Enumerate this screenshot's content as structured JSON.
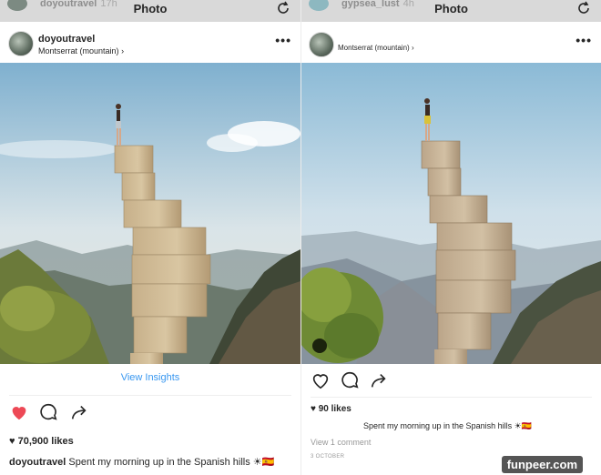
{
  "left_post": {
    "story_username": "doyoutravel",
    "story_time": "17h",
    "title": "Photo",
    "username": "doyoutravel",
    "location": "Montserrat (mountain)",
    "location_chevron": "›",
    "more": "•••",
    "view_insights": "View Insights",
    "likes": "70,900 likes",
    "caption_user": "doyoutravel",
    "caption_text": "Spent my morning up in the Spanish hills ☀🇪🇸"
  },
  "right_post": {
    "story_username": "gypsea_lust",
    "story_time": "4h",
    "title": "Photo",
    "location": "Montserrat (mountain)",
    "location_chevron": "›",
    "more": "•••",
    "likes": "90 likes",
    "caption_text": "Spent my morning up in the Spanish hills ☀🇪🇸",
    "view_comments": "View 1 comment",
    "date": "3 OCTOBER"
  },
  "icons": {
    "refresh": "refresh-icon",
    "heart_filled": "heart-filled-icon",
    "heart_outline": "heart-outline-icon",
    "comment": "comment-icon",
    "share": "share-icon",
    "more": "more-icon",
    "user_tag": "user-tag-icon"
  },
  "colors": {
    "like_red": "#ed4956",
    "link_blue": "#3897f0",
    "text": "#262626"
  },
  "watermark": "funpeer.com"
}
